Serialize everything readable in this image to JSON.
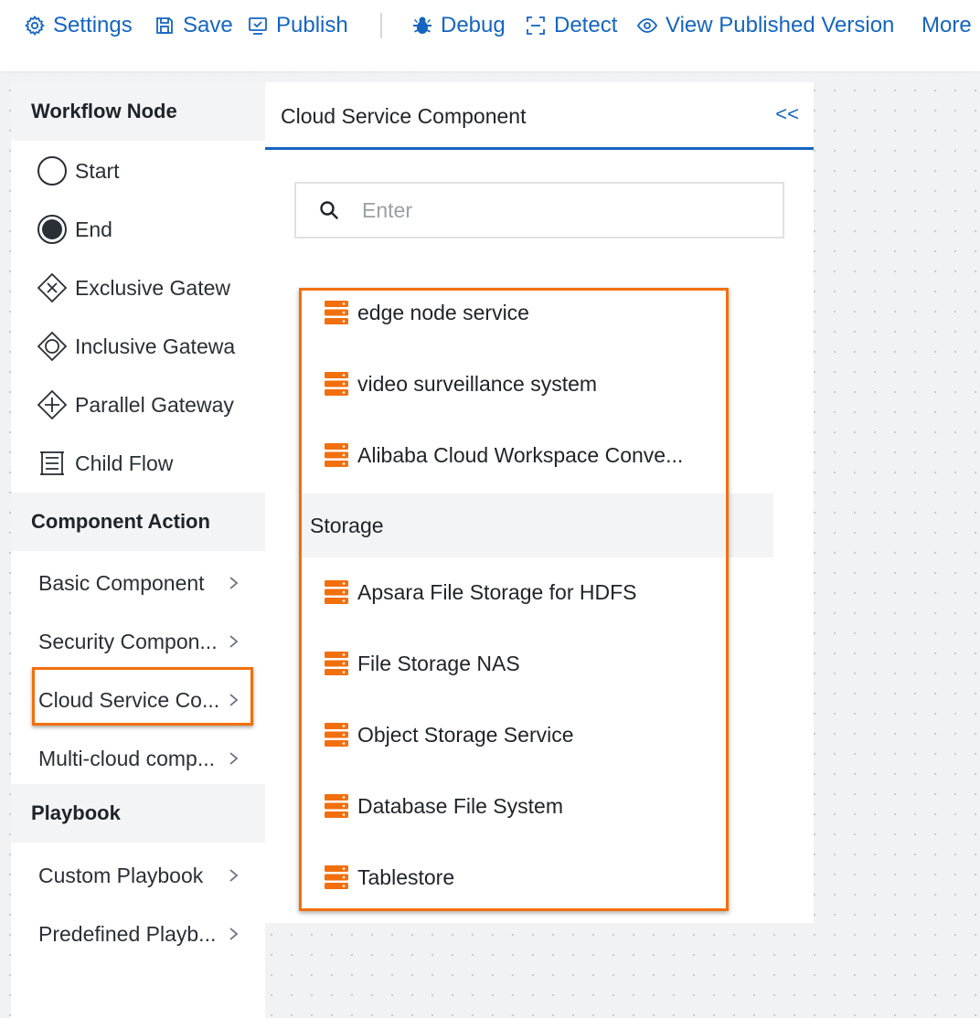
{
  "toolbar": {
    "settings": "Settings",
    "save": "Save",
    "publish": "Publish",
    "debug": "Debug",
    "detect": "Detect",
    "view_published": "View Published Version",
    "more": "More"
  },
  "sidebar": {
    "workflow_node": {
      "title": "Workflow Node",
      "items": [
        {
          "label": "Start",
          "icon": "start-circle-icon"
        },
        {
          "label": "End",
          "icon": "end-circle-icon"
        },
        {
          "label": "Exclusive Gatew",
          "icon": "exclusive-gateway-icon"
        },
        {
          "label": "Inclusive Gatewa",
          "icon": "inclusive-gateway-icon"
        },
        {
          "label": "Parallel Gateway",
          "icon": "parallel-gateway-icon"
        },
        {
          "label": "Child Flow",
          "icon": "child-flow-icon"
        }
      ]
    },
    "component_action": {
      "title": "Component Action",
      "items": [
        {
          "label": "Basic Component"
        },
        {
          "label": "Security Compon..."
        },
        {
          "label": "Cloud Service Co..."
        },
        {
          "label": "Multi-cloud comp..."
        }
      ]
    },
    "playbook": {
      "title": "Playbook",
      "items": [
        {
          "label": "Custom Playbook"
        },
        {
          "label": "Predefined Playb..."
        }
      ]
    }
  },
  "panel": {
    "title": "Cloud Service Component",
    "collapse_label": "<<",
    "search_placeholder": "Enter",
    "search_value": "",
    "items_top": [
      {
        "label": "edge node service"
      },
      {
        "label": "video surveillance system"
      },
      {
        "label": "Alibaba Cloud Workspace Conve..."
      }
    ],
    "storage_group": {
      "title": "Storage",
      "items": [
        {
          "label": "Apsara File Storage for HDFS"
        },
        {
          "label": "File Storage NAS"
        },
        {
          "label": "Object Storage Service"
        },
        {
          "label": "Database File System"
        },
        {
          "label": "Tablestore"
        }
      ]
    }
  },
  "colors": {
    "accent": "#1565c0",
    "highlight": "#f26f0e",
    "service_icon": "#f26f0e"
  }
}
